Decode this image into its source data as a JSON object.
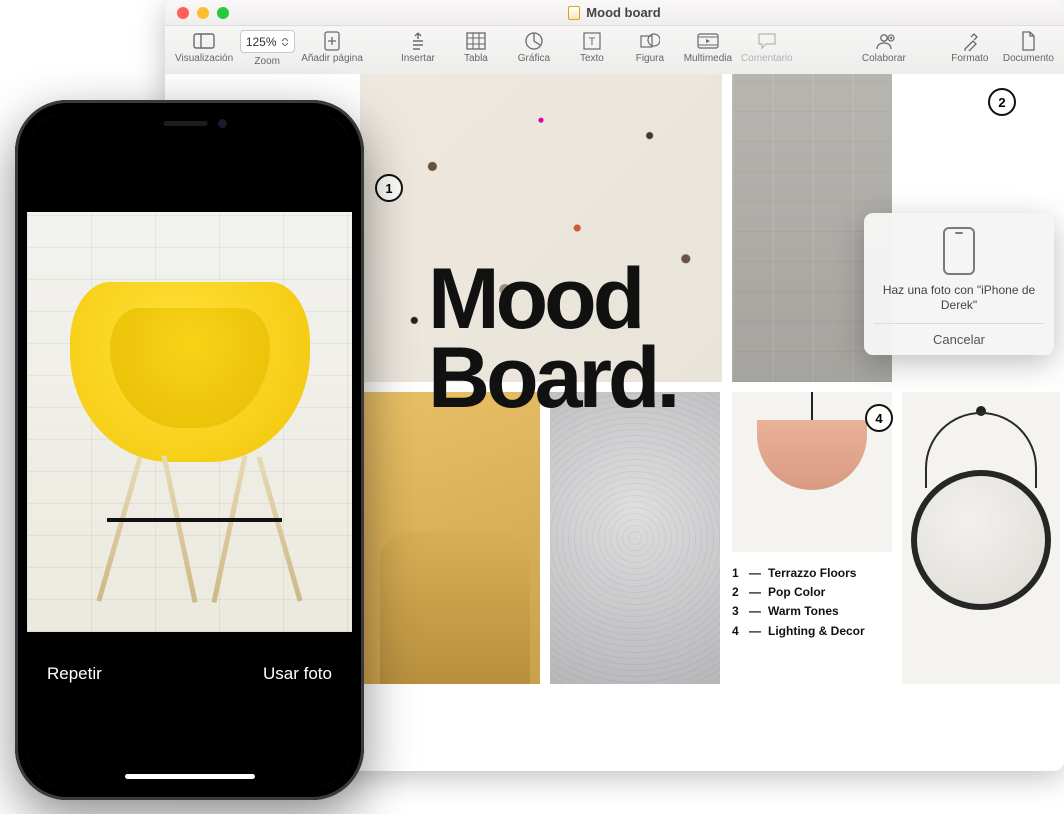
{
  "window": {
    "title": "Mood board",
    "traffic_colors": {
      "close": "#ff5f57",
      "min": "#febc2e",
      "max": "#28c840"
    }
  },
  "toolbar": {
    "view": "Visualización",
    "zoom_value": "125%",
    "zoom_label": "Zoom",
    "add_page": "Añadir página",
    "insert": "Insertar",
    "table": "Tabla",
    "chart": "Gráfica",
    "text": "Texto",
    "shape": "Figura",
    "media": "Multimedia",
    "comment": "Comentario",
    "collaborate": "Colaborar",
    "format": "Formato",
    "document": "Documento"
  },
  "document": {
    "title_line1": "Mood",
    "title_line2": "Board.",
    "badges": {
      "b1": "1",
      "b2": "2",
      "b4": "4"
    },
    "legend": [
      {
        "n": "1",
        "label": "Terrazzo Floors"
      },
      {
        "n": "2",
        "label": "Pop Color"
      },
      {
        "n": "3",
        "label": "Warm Tones"
      },
      {
        "n": "4",
        "label": "Lighting & Decor"
      }
    ]
  },
  "popover": {
    "message": "Haz una foto con \"iPhone de Derek\"",
    "cancel": "Cancelar"
  },
  "iphone": {
    "retake": "Repetir",
    "use": "Usar foto"
  }
}
